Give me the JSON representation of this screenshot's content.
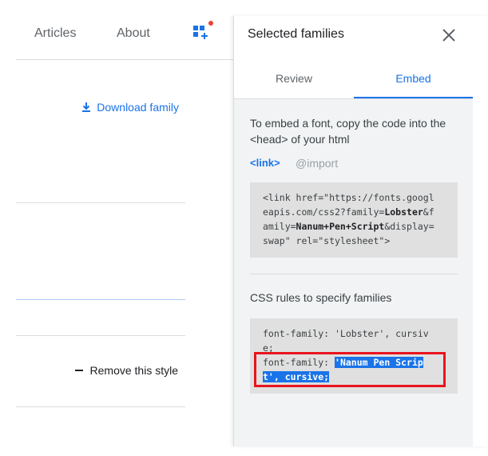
{
  "nav": {
    "articles": "Articles",
    "about": "About"
  },
  "main": {
    "download_label": "Download family",
    "remove_label": "Remove this style"
  },
  "panel": {
    "title": "Selected families",
    "tabs": [
      {
        "label": "Review",
        "active": false
      },
      {
        "label": "Embed",
        "active": true
      }
    ],
    "instructions": "To embed a font, copy the code into the <head> of your html",
    "embed_options": [
      "<link>",
      "@import"
    ],
    "link_code": {
      "l1_a": "<link href=\"https://fonts.googl",
      "l2_a": "eapis.com/css2?family=",
      "l2_b": "Lobster",
      "l2_c": "&f",
      "l3_a": "amily=",
      "l3_b": "Nanum+Pen+Script",
      "l3_c": "&display=",
      "l4_a": "swap\" rel=\"stylesheet\">"
    },
    "css_label": "CSS rules to specify families",
    "css_code": {
      "l1": "font-family: 'Lobster', cursiv",
      "l2": "e;",
      "l3_a": "font-family: ",
      "l3_b": "'Nanum Pen Scrip",
      "l4": "t', cursive;"
    }
  },
  "colors": {
    "accent": "#1a73e8",
    "annotation": "#e8141e",
    "notification": "#ea4335"
  },
  "icons": {
    "download": "download-icon",
    "remove": "minus-icon",
    "families": "font-families-icon",
    "close": "close-icon"
  }
}
